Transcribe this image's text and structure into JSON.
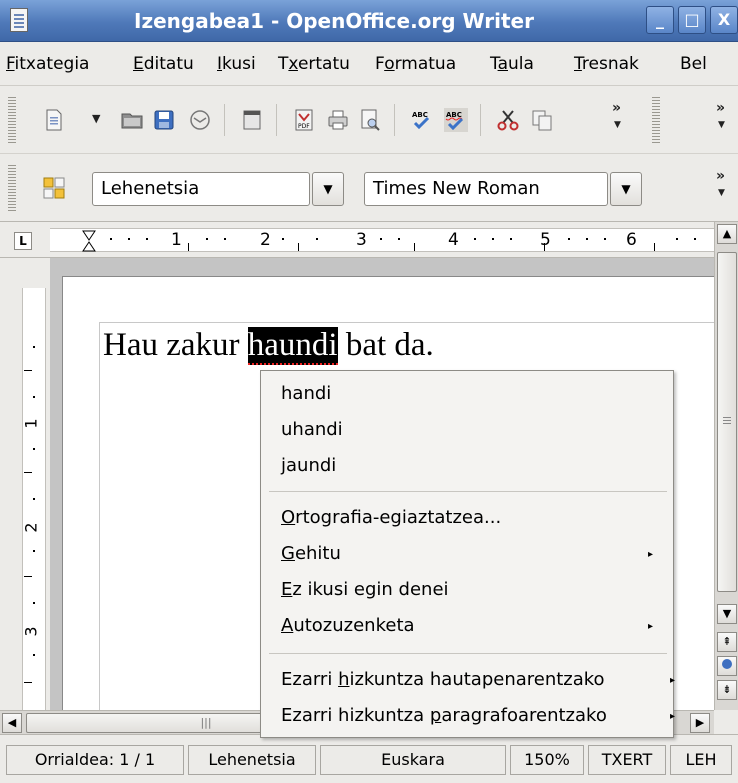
{
  "window": {
    "title": "Izengabea1 - OpenOffice.org Writer",
    "buttons": {
      "minimize": "_",
      "maximize": "□",
      "close": "X"
    }
  },
  "menubar": [
    {
      "label": "Fitxategia"
    },
    {
      "label": "Editatu"
    },
    {
      "label": "Ikusi"
    },
    {
      "label": "Txertatu"
    },
    {
      "label": "Formatua"
    },
    {
      "label": "Taula"
    },
    {
      "label": "Tresnak"
    },
    {
      "label": "Bel"
    }
  ],
  "toolbar1": {
    "icons": [
      "new-document-icon",
      "open-folder-icon",
      "save-icon",
      "mail-icon",
      "edit-file-icon",
      "pdf-export-icon",
      "print-icon",
      "print-preview-icon",
      "spellcheck-icon",
      "autospellcheck-icon",
      "cut-icon",
      "copy-icon"
    ],
    "overflow": "»"
  },
  "toolbar2": {
    "style_value": "Lehenetsia",
    "font_value": "Times New Roman",
    "overflow": "»"
  },
  "ruler": {
    "tab_selector": "L",
    "numbers": [
      "1",
      "2",
      "3",
      "4",
      "5",
      "6"
    ]
  },
  "vruler": {
    "numbers": [
      "1",
      "2",
      "3"
    ]
  },
  "document": {
    "text_before": "Hau zakur ",
    "selected_word": "haundi",
    "text_after": " bat da."
  },
  "context_menu": {
    "suggestions": [
      "handi",
      "uhandi",
      "jaundi"
    ],
    "spellcheck": {
      "mnemonic": "O",
      "rest": "rtografia-egiaztatzea..."
    },
    "add": {
      "mnemonic": "G",
      "rest": "ehitu"
    },
    "ignore_all": {
      "mnemonic": "E",
      "rest": "z ikusi egin denei"
    },
    "autocorrect": {
      "mnemonic": "A",
      "rest": "utozuzenketa"
    },
    "lang_selection": {
      "before": "Ezarri ",
      "mnemonic": "h",
      "after": "izkuntza hautapenarentzako"
    },
    "lang_paragraph": {
      "before": "Ezarri hizkuntza ",
      "mnemonic": "p",
      "after": "aragrafoarentzako"
    },
    "submenu_arrow": "▸"
  },
  "statusbar": {
    "page": "Orrialdea: 1 / 1",
    "style": "Lehenetsia",
    "language": "Euskara",
    "zoom": "150%",
    "insert_mode": "TXERT",
    "selection_mode": "LEH"
  },
  "colors": {
    "titlebar": "#4f79b9",
    "menubar": "#ecebe8",
    "spell_underline": "#e22222"
  }
}
